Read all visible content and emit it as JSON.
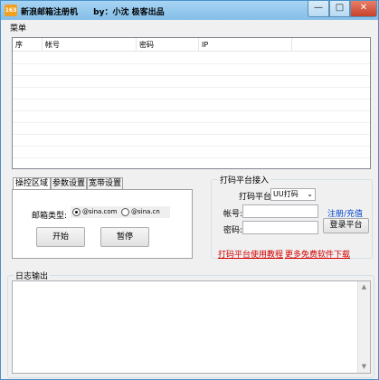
{
  "window": {
    "app_icon_text": "163",
    "title": "新浪邮箱注册机",
    "author": "by：小沈 极客出品",
    "controls": {
      "minimize": "—",
      "maximize": "□",
      "close": "✕"
    }
  },
  "menu": {
    "items": [
      "菜单"
    ]
  },
  "account_list": {
    "columns": [
      "序",
      "帐号",
      "密码",
      "IP"
    ],
    "rows": []
  },
  "left_panel": {
    "tabs": [
      "操控区域",
      "参数设置",
      "宽带设置"
    ],
    "active_tab": 0,
    "mail_type_label": "邮箱类型:",
    "mail_options": [
      "@sina.com",
      "@sina.cn"
    ],
    "mail_selected": "@sina.com",
    "start_button": "开始",
    "pause_button": "暂停"
  },
  "captcha_panel": {
    "caption": "打码平台接入",
    "platform_label": "打码平台",
    "platform_value": "UU打码",
    "account_label": "帐号:",
    "account_value": "",
    "password_label": "密码:",
    "password_value": "",
    "register_link": "注册/充值",
    "login_button": "登录平台",
    "tutorial_link": "打码平台使用教程",
    "more_software_link": "更多免费软件下载"
  },
  "log": {
    "caption": "日志输出",
    "content": ""
  }
}
